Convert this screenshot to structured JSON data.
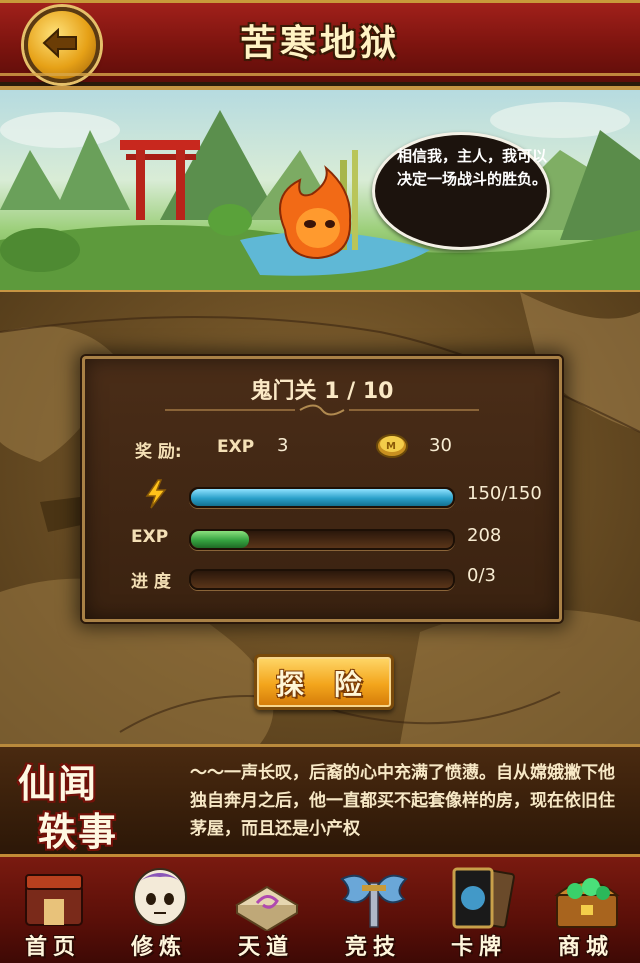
{
  "header": {
    "title": "苦寒地狱"
  },
  "banner": {
    "speech": "相信我，主人，我可以决定一场战斗的胜负。"
  },
  "stage": {
    "name": "鬼门关 1 / 10",
    "reward_label": "奖 励:",
    "exp_label": "EXP",
    "reward_exp": "3",
    "reward_coins": "30",
    "energy": {
      "text": "150/150",
      "fraction": 1.0
    },
    "exp": {
      "label": "EXP",
      "text": "208",
      "fraction": 0.22
    },
    "progress": {
      "label": "进 度",
      "text": "0/3",
      "fraction": 0.0
    },
    "explore_button": "探 险"
  },
  "story": {
    "logo_line1": "仙闻",
    "logo_line2": "轶事",
    "text": "～～一声长叹，后裔的心中充满了愤懑。自从嫦娥撇下他独自奔月之后，他一直都买不起套像样的房，现在依旧住茅屋，而且还是小产权"
  },
  "nav": {
    "items": [
      {
        "label": "首页",
        "icon": "home-icon"
      },
      {
        "label": "修炼",
        "icon": "training-icon"
      },
      {
        "label": "天道",
        "icon": "heaven-path-icon"
      },
      {
        "label": "竞技",
        "icon": "arena-icon"
      },
      {
        "label": "卡牌",
        "icon": "cards-icon"
      },
      {
        "label": "商城",
        "icon": "shop-icon"
      }
    ]
  },
  "colors": {
    "header_red": "#7d140f",
    "gold": "#c69543",
    "energy_blue": "#2aa0c9",
    "exp_green": "#35a240"
  }
}
